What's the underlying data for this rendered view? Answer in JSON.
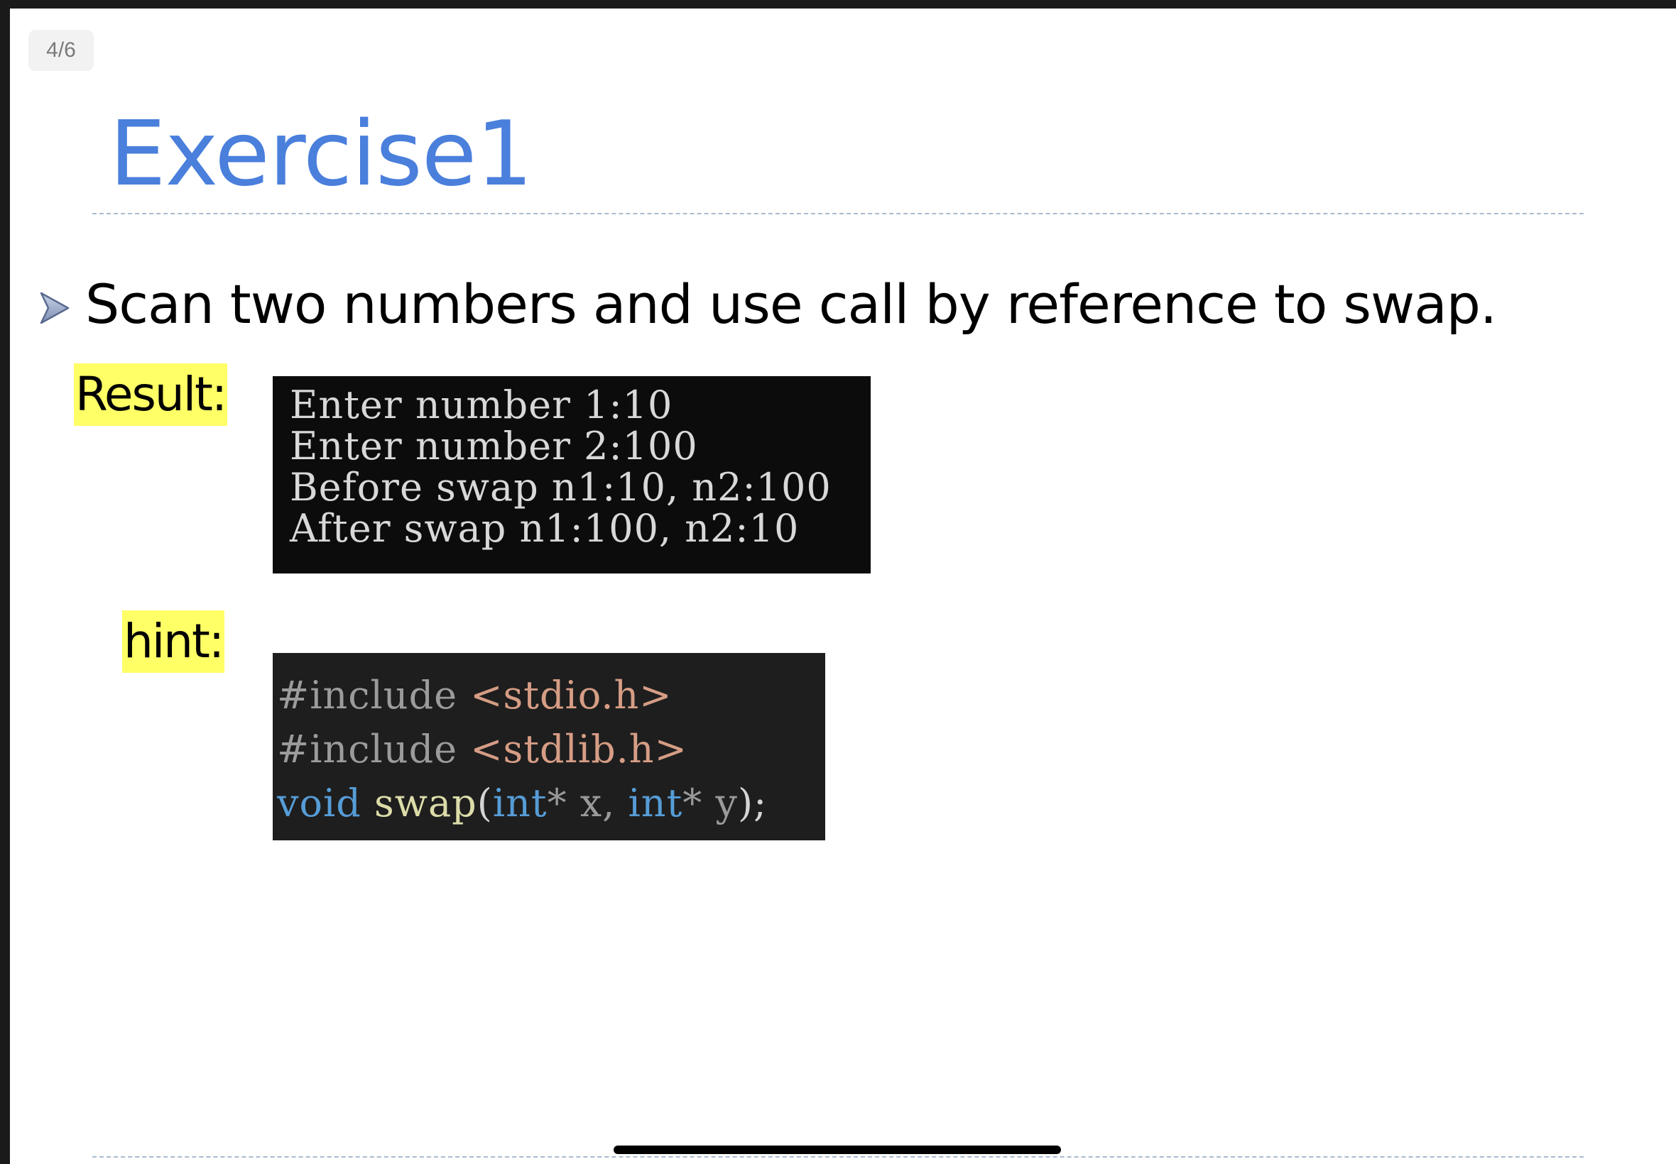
{
  "viewer": {
    "page_indicator": "4/6"
  },
  "slide": {
    "title": "Exercise1",
    "bullet": "Scan two numbers and use call by reference to swap.",
    "result_label": "Result:",
    "hint_label": "hint:",
    "console_output": [
      "Enter number 1:10",
      "Enter number 2:100",
      "Before swap n1:10, n2:100",
      "After swap n1:100, n2:10"
    ],
    "code": {
      "line1": {
        "directive": "#include",
        "header": "<stdio.h>"
      },
      "line2": {
        "directive": "#include",
        "header": "<stdlib.h>"
      },
      "line3": {
        "kw_void": "void",
        "fn_name": "swap",
        "open_paren": "(",
        "kw_int1": "int",
        "param1": "* x,",
        "kw_int2": "int",
        "param2": "* y",
        "close": ");"
      }
    }
  },
  "colors": {
    "title": "#4a7fdc",
    "highlight": "#ffff66",
    "console_bg": "#0c0c0c",
    "code_bg": "#1e1e1e"
  },
  "icons": {
    "bullet": "arrowhead-bullet-icon"
  }
}
